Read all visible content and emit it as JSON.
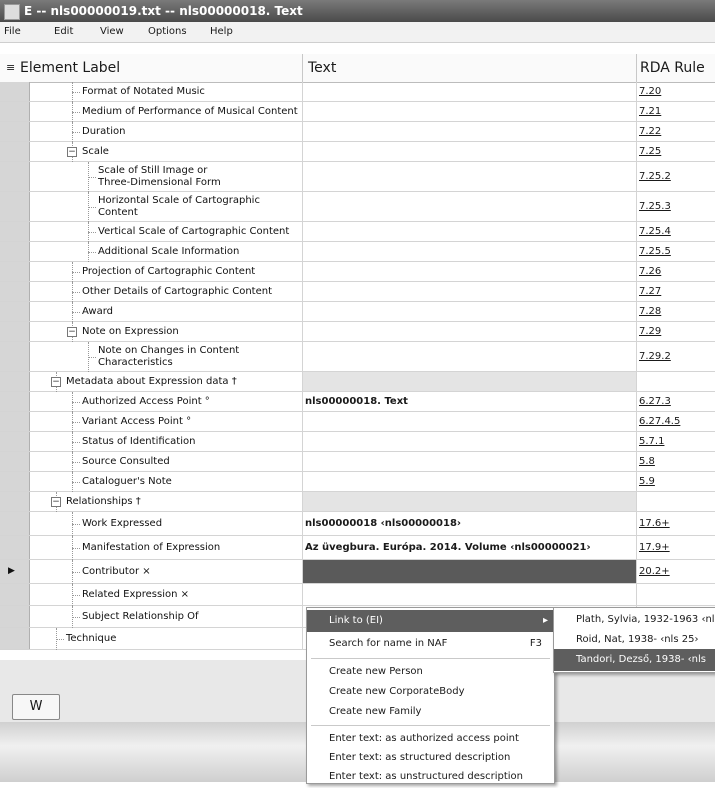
{
  "window": {
    "title": "E  --  nls00000019.txt  --  nls00000018. Text"
  },
  "menu": [
    "File",
    "Edit",
    "View",
    "Options",
    "Help"
  ],
  "columns": {
    "label": "Element Label",
    "text": "Text",
    "rule": "RDA Rule"
  },
  "rows": [
    {
      "label": "Format of Notated Music",
      "rule": "7.20"
    },
    {
      "label": "Medium of Performance of Musical Content",
      "rule": "7.21"
    },
    {
      "label": "Duration",
      "rule": "7.22"
    },
    {
      "label": "Scale",
      "rule": "7.25"
    },
    {
      "label": "Scale of Still Image or",
      "label2": "Three-Dimensional Form",
      "rule": "7.25.2"
    },
    {
      "label": "Horizontal Scale of Cartographic",
      "label2": "Content",
      "rule": "7.25.3"
    },
    {
      "label": "Vertical Scale of Cartographic Content",
      "rule": "7.25.4"
    },
    {
      "label": "Additional Scale Information",
      "rule": "7.25.5"
    },
    {
      "label": "Projection of Cartographic Content",
      "rule": "7.26"
    },
    {
      "label": "Other Details of Cartographic Content",
      "rule": "7.27"
    },
    {
      "label": "Award",
      "rule": "7.28"
    },
    {
      "label": "Note on Expression",
      "rule": "7.29"
    },
    {
      "label": "Note on Changes in Content",
      "label2": "Characteristics",
      "rule": "7.29.2"
    },
    {
      "label": "Metadata about Expression data †",
      "text": "",
      "rule": ""
    },
    {
      "label": "Authorized Access Point °",
      "text": "nls00000018. Text",
      "rule": "6.27.3"
    },
    {
      "label": "Variant Access Point °",
      "rule": "6.27.4.5"
    },
    {
      "label": "Status of Identification",
      "rule": "5.7.1"
    },
    {
      "label": "Source Consulted",
      "rule": "5.8"
    },
    {
      "label": "Cataloguer's Note",
      "rule": "5.9"
    },
    {
      "label": "Relationships †",
      "text": "",
      "rule": ""
    },
    {
      "label": "Work Expressed",
      "text": "nls00000018 ‹nls00000018›",
      "rule": "17.6+"
    },
    {
      "label": "Manifestation of Expression",
      "text": "Az üvegbura. Európa. 2014. Volume ‹nls00000021›",
      "rule": "17.9+"
    },
    {
      "label": "Contributor ×",
      "text": "",
      "rule": "20.2+"
    },
    {
      "label": "Related Expression ×",
      "rule": ""
    },
    {
      "label": "Subject Relationship Of",
      "rule": ""
    },
    {
      "label": "Technique",
      "rule": ""
    }
  ],
  "bottom_button": "W",
  "context_menu": {
    "link_to": "Link to  (EI)",
    "search": "Search for name in NAF",
    "search_shortcut": "F3",
    "create_person": "Create new Person",
    "create_corporate": "Create new CorporateBody",
    "create_family": "Create new Family",
    "enter_aap": "Enter text: as authorized access point",
    "enter_struct": "Enter text: as structured description",
    "enter_unstruct": "Enter text: as unstructured description"
  },
  "submenu": [
    "Plath, Sylvia, 1932-1963 ‹nl",
    "Roid, Nat, 1938- ‹nls    25›",
    "Tandori, Dezső, 1938- ‹nls"
  ]
}
